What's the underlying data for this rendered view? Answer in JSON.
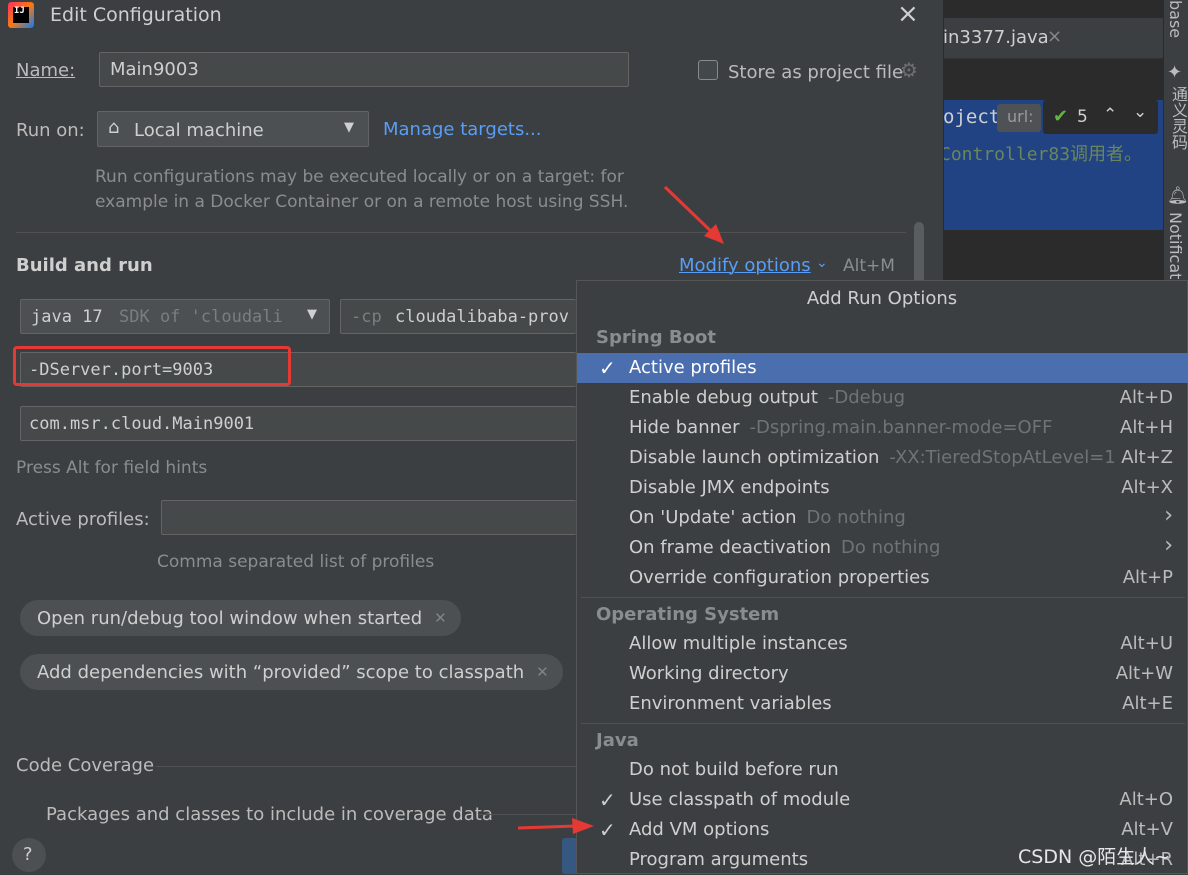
{
  "editor": {
    "tab_label": "in3377.java",
    "code_line1": "oject(",
    "url_hint": "url:",
    "check_count": "5",
    "code_line2": "Controller83调用者。",
    "side_tab_top": "base",
    "side_tab_tongyi": "通义灵码",
    "side_tab_notifications": "Notificat"
  },
  "dialog": {
    "title": "Edit Configuration",
    "name_label": "Name:",
    "name_value": "Main9003",
    "store_label": "Store as project file",
    "run_on_label": "Run on:",
    "run_on_value": "Local machine",
    "manage_targets": "Manage targets...",
    "run_on_hint_1": "Run configurations may be executed locally or on a target: for",
    "run_on_hint_2": "example in a Docker Container or on a remote host using SSH.",
    "build_run_title": "Build and run",
    "modify_options": "Modify options",
    "modify_shortcut": "Alt+M",
    "jdk_java": "java 17",
    "jdk_sdk": "SDK of 'cloudali",
    "cp_prefix": "-cp",
    "cp_value": "cloudalibaba-prov",
    "vm_options_value": "-DServer.port=9003",
    "main_class_value": "com.msr.cloud.Main9001",
    "field_hints": "Press Alt for field hints",
    "active_profiles_label": "Active profiles:",
    "active_profiles_hint": "Comma separated list of profiles",
    "chip_1": "Open run/debug tool window when started",
    "chip_2": "Add dependencies with “provided” scope to classpath",
    "code_coverage": "Code Coverage",
    "coverage_packages": "Packages and classes to include in coverage data",
    "help": "?"
  },
  "popup": {
    "title": "Add Run Options",
    "sections": [
      {
        "name": "Spring Boot"
      },
      {
        "name": "Operating System"
      },
      {
        "name": "Java"
      }
    ],
    "items": [
      {
        "label": "Active profiles",
        "hint": "",
        "shortcut": "",
        "checked": "✓"
      },
      {
        "label": "Enable debug output",
        "hint": "-Ddebug",
        "shortcut": "Alt+D",
        "checked": ""
      },
      {
        "label": "Hide banner",
        "hint": "-Dspring.main.banner-mode=OFF",
        "shortcut": "Alt+H",
        "checked": ""
      },
      {
        "label": "Disable launch optimization",
        "hint": "-XX:TieredStopAtLevel=1",
        "shortcut": "Alt+Z",
        "checked": ""
      },
      {
        "label": "Disable JMX endpoints",
        "hint": "",
        "shortcut": "Alt+X",
        "checked": ""
      },
      {
        "label": "On 'Update' action",
        "hint": "Do nothing",
        "shortcut": "›",
        "checked": ""
      },
      {
        "label": "On frame deactivation",
        "hint": "Do nothing",
        "shortcut": "›",
        "checked": ""
      },
      {
        "label": "Override configuration properties",
        "hint": "",
        "shortcut": "Alt+P",
        "checked": ""
      },
      {
        "label": "Allow multiple instances",
        "hint": "",
        "shortcut": "Alt+U",
        "checked": ""
      },
      {
        "label": "Working directory",
        "hint": "",
        "shortcut": "Alt+W",
        "checked": ""
      },
      {
        "label": "Environment variables",
        "hint": "",
        "shortcut": "Alt+E",
        "checked": ""
      },
      {
        "label": "Do not build before run",
        "hint": "",
        "shortcut": "",
        "checked": ""
      },
      {
        "label": "Use classpath of module",
        "hint": "",
        "shortcut": "Alt+O",
        "checked": "✓"
      },
      {
        "label": "Add VM options",
        "hint": "",
        "shortcut": "Alt+V",
        "checked": "✓"
      },
      {
        "label": "Program arguments",
        "hint": "",
        "shortcut": "Alt+R",
        "checked": ""
      }
    ]
  },
  "watermark": "CSDN @陌生人~",
  "colors": {
    "background": "#3c3f41",
    "selection": "#4b6eaf",
    "link": "#589df6",
    "highlight_box": "#e53935",
    "arrow": "#e53935"
  }
}
